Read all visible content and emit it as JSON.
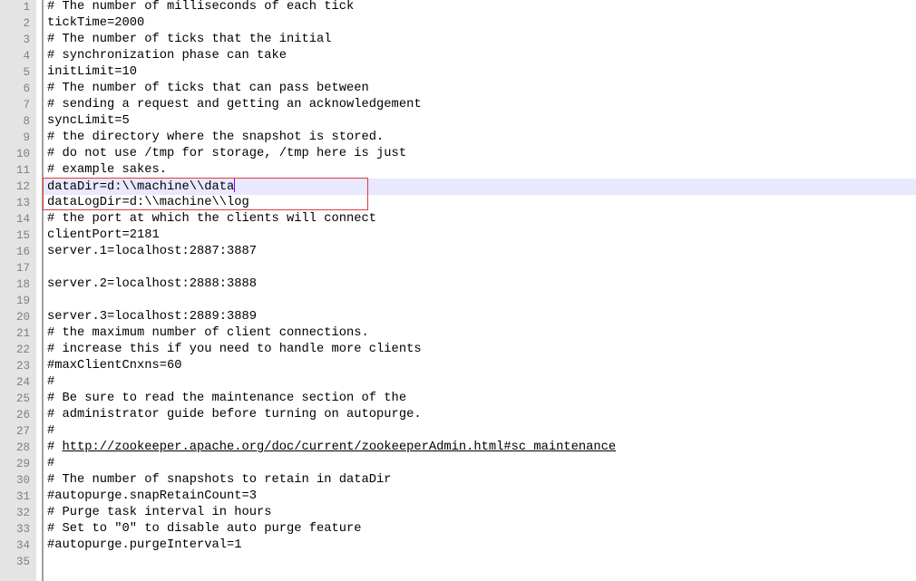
{
  "editor": {
    "current_line": 12,
    "highlight_box_color": "#e03c3c",
    "lines": [
      "# The number of milliseconds of each tick",
      "tickTime=2000",
      "# The number of ticks that the initial",
      "# synchronization phase can take",
      "initLimit=10",
      "# The number of ticks that can pass between",
      "# sending a request and getting an acknowledgement",
      "syncLimit=5",
      "# the directory where the snapshot is stored.",
      "# do not use /tmp for storage, /tmp here is just",
      "# example sakes.",
      "dataDir=d:\\\\machine\\\\data",
      "dataLogDir=d:\\\\machine\\\\log",
      "# the port at which the clients will connect",
      "clientPort=2181",
      "server.1=localhost:2887:3887",
      "",
      "server.2=localhost:2888:3888",
      "",
      "server.3=localhost:2889:3889",
      "# the maximum number of client connections.",
      "# increase this if you need to handle more clients",
      "#maxClientCnxns=60",
      "#",
      "# Be sure to read the maintenance section of the",
      "# administrator guide before turning on autopurge.",
      "#",
      "# ",
      "#",
      "# The number of snapshots to retain in dataDir",
      "#autopurge.snapRetainCount=3",
      "# Purge task interval in hours",
      "# Set to \"0\" to disable auto purge feature",
      "#autopurge.purgeInterval=1",
      ""
    ],
    "link_line": 28,
    "link_text": "http://zookeeper.apache.org/doc/current/zookeeperAdmin.html#sc_maintenance"
  }
}
